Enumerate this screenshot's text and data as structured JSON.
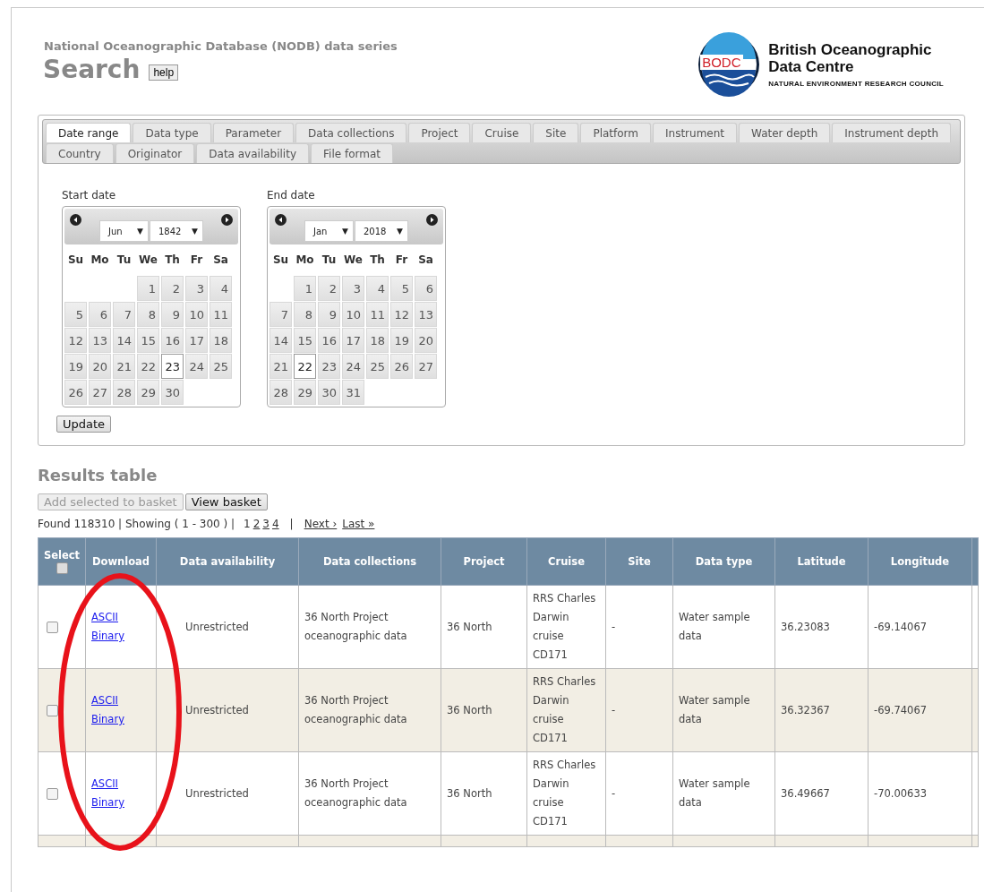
{
  "header": {
    "subtitle": "National Oceanographic Database (NODB) data series",
    "title": "Search",
    "help_button": "help",
    "logo": {
      "badge": "BODC",
      "name_line1": "British Oceanographic",
      "name_line2": "Data Centre",
      "council": "NATURAL ENVIRONMENT RESEARCH COUNCIL"
    }
  },
  "tabs": [
    {
      "label": "Date range",
      "selected": true
    },
    {
      "label": "Data type",
      "selected": false
    },
    {
      "label": "Parameter",
      "selected": false
    },
    {
      "label": "Data collections",
      "selected": false
    },
    {
      "label": "Project",
      "selected": false
    },
    {
      "label": "Cruise",
      "selected": false
    },
    {
      "label": "Site",
      "selected": false
    },
    {
      "label": "Platform",
      "selected": false
    },
    {
      "label": "Instrument",
      "selected": false
    },
    {
      "label": "Water depth",
      "selected": false
    },
    {
      "label": "Instrument depth",
      "selected": false
    },
    {
      "label": "Country",
      "selected": false
    },
    {
      "label": "Originator",
      "selected": false
    },
    {
      "label": "Data availability",
      "selected": false
    },
    {
      "label": "File format",
      "selected": false
    }
  ],
  "calendars": [
    {
      "label": "Start date",
      "month": {
        "value": "Jun",
        "caret": "▼"
      },
      "year": {
        "value": "1842",
        "caret": "▼"
      },
      "weekdays": [
        "Su",
        "Mo",
        "Tu",
        "We",
        "Th",
        "Fr",
        "Sa"
      ],
      "weeks": [
        {
          "kind": "first",
          "days": [
            {
              "day": "1",
              "selected": false
            },
            {
              "day": "2",
              "selected": false
            },
            {
              "day": "3",
              "selected": false
            },
            {
              "day": "4",
              "selected": false
            }
          ]
        },
        {
          "kind": "week",
          "days": [
            {
              "day": "5",
              "selected": false
            },
            {
              "day": "6",
              "selected": false
            },
            {
              "day": "7",
              "selected": false
            },
            {
              "day": "8",
              "selected": false
            },
            {
              "day": "9",
              "selected": false
            },
            {
              "day": "10",
              "selected": false
            },
            {
              "day": "11",
              "selected": false
            }
          ]
        },
        {
          "kind": "week",
          "days": [
            {
              "day": "12",
              "selected": false
            },
            {
              "day": "13",
              "selected": false
            },
            {
              "day": "14",
              "selected": false
            },
            {
              "day": "15",
              "selected": false
            },
            {
              "day": "16",
              "selected": false
            },
            {
              "day": "17",
              "selected": false
            },
            {
              "day": "18",
              "selected": false
            }
          ]
        },
        {
          "kind": "week",
          "days": [
            {
              "day": "19",
              "selected": false
            },
            {
              "day": "20",
              "selected": false
            },
            {
              "day": "21",
              "selected": false
            },
            {
              "day": "22",
              "selected": false
            },
            {
              "day": "23",
              "selected": true
            },
            {
              "day": "24",
              "selected": false
            },
            {
              "day": "25",
              "selected": false
            }
          ]
        },
        {
          "kind": "week",
          "days": [
            {
              "day": "26",
              "selected": false
            },
            {
              "day": "27",
              "selected": false
            },
            {
              "day": "28",
              "selected": false
            },
            {
              "day": "29",
              "selected": false
            },
            {
              "day": "30",
              "selected": false
            }
          ]
        }
      ]
    },
    {
      "label": "End date",
      "month": {
        "value": "Jan",
        "caret": "▼"
      },
      "year": {
        "value": "2018",
        "caret": "▼"
      },
      "weekdays": [
        "Su",
        "Mo",
        "Tu",
        "We",
        "Th",
        "Fr",
        "Sa"
      ],
      "weeks": [
        {
          "kind": "first",
          "days": [
            {
              "day": "1",
              "selected": false
            },
            {
              "day": "2",
              "selected": false
            },
            {
              "day": "3",
              "selected": false
            },
            {
              "day": "4",
              "selected": false
            },
            {
              "day": "5",
              "selected": false
            },
            {
              "day": "6",
              "selected": false
            }
          ]
        },
        {
          "kind": "week",
          "days": [
            {
              "day": "7",
              "selected": false
            },
            {
              "day": "8",
              "selected": false
            },
            {
              "day": "9",
              "selected": false
            },
            {
              "day": "10",
              "selected": false
            },
            {
              "day": "11",
              "selected": false
            },
            {
              "day": "12",
              "selected": false
            },
            {
              "day": "13",
              "selected": false
            }
          ]
        },
        {
          "kind": "week",
          "days": [
            {
              "day": "14",
              "selected": false
            },
            {
              "day": "15",
              "selected": false
            },
            {
              "day": "16",
              "selected": false
            },
            {
              "day": "17",
              "selected": false
            },
            {
              "day": "18",
              "selected": false
            },
            {
              "day": "19",
              "selected": false
            },
            {
              "day": "20",
              "selected": false
            }
          ]
        },
        {
          "kind": "week",
          "days": [
            {
              "day": "21",
              "selected": false
            },
            {
              "day": "22",
              "selected": true
            },
            {
              "day": "23",
              "selected": false
            },
            {
              "day": "24",
              "selected": false
            },
            {
              "day": "25",
              "selected": false
            },
            {
              "day": "26",
              "selected": false
            },
            {
              "day": "27",
              "selected": false
            }
          ]
        },
        {
          "kind": "week",
          "days": [
            {
              "day": "28",
              "selected": false
            },
            {
              "day": "29",
              "selected": false
            },
            {
              "day": "30",
              "selected": false
            },
            {
              "day": "31",
              "selected": false
            }
          ]
        }
      ]
    }
  ],
  "update_button": "Update",
  "results": {
    "title": "Results table",
    "buttons": [
      {
        "label": "Add selected to basket",
        "disabled": true
      },
      {
        "label": "View basket",
        "disabled": false
      }
    ],
    "summary": "Found 118310 | Showing ( 1 - 300 ) |",
    "pages": [
      {
        "label": "1",
        "selected": true
      },
      {
        "label": "2",
        "selected": false
      },
      {
        "label": "3",
        "selected": false
      },
      {
        "label": "4",
        "selected": false
      }
    ],
    "separator": "|",
    "next": "Next ›",
    "last": "Last »",
    "columns": [
      "Select",
      "Download",
      "Data availability",
      "Data collections",
      "Project",
      "Cruise",
      "Site",
      "Data type",
      "Latitude",
      "Longitude"
    ],
    "select_all_checked": false,
    "rows": [
      {
        "checked": false,
        "downloads": [
          "ASCII",
          "Binary"
        ],
        "availability": "Unrestricted",
        "collection": "36 North Project oceanographic data",
        "project": "36 North",
        "cruise": "RRS Charles Darwin cruise CD171",
        "site": "-",
        "data_type": "Water sample data",
        "latitude": "36.23083",
        "longitude": "-69.14067"
      },
      {
        "checked": false,
        "downloads": [
          "ASCII",
          "Binary"
        ],
        "availability": "Unrestricted",
        "collection": "36 North Project oceanographic data",
        "project": "36 North",
        "cruise": "RRS Charles Darwin cruise CD171",
        "site": "-",
        "data_type": "Water sample data",
        "latitude": "36.32367",
        "longitude": "-69.74067"
      },
      {
        "checked": false,
        "downloads": [
          "ASCII",
          "Binary"
        ],
        "availability": "Unrestricted",
        "collection": "36 North Project oceanographic data",
        "project": "36 North",
        "cruise": "RRS Charles Darwin cruise CD171",
        "site": "-",
        "data_type": "Water sample data",
        "latitude": "36.49667",
        "longitude": "-70.00633"
      }
    ]
  }
}
